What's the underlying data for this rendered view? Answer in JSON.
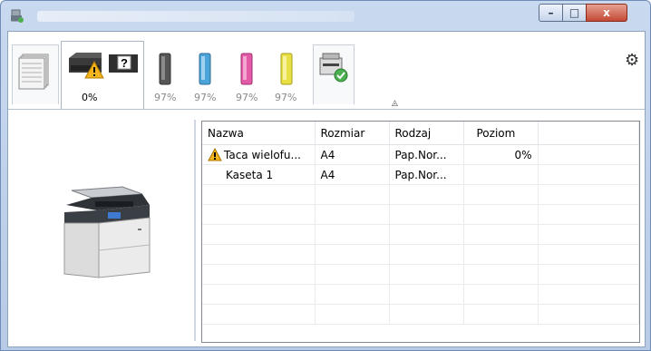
{
  "window": {
    "minimize_label": "–",
    "maximize_label": "□",
    "close_label": "x"
  },
  "toolbar": {
    "tabs": [
      {
        "name": "paper-stack",
        "label": ""
      },
      {
        "name": "printer-status",
        "label": "0%"
      },
      {
        "name": "toner-black",
        "label": "97%",
        "color": "#4d4d4d"
      },
      {
        "name": "toner-cyan",
        "label": "97%",
        "color": "#4aa3d9"
      },
      {
        "name": "toner-magenta",
        "label": "97%",
        "color": "#e45aa7"
      },
      {
        "name": "toner-yellow",
        "label": "97%",
        "color": "#e8df45"
      },
      {
        "name": "device-ok",
        "label": ""
      }
    ],
    "collapse_glyph": "◬",
    "settings_glyph": "⚙",
    "unknown_glyph": "?"
  },
  "table": {
    "columns": [
      "Nazwa",
      "Rozmiar",
      "Rodzaj",
      "Poziom"
    ],
    "rows": [
      {
        "name": "Taca wielofu...",
        "size": "A4",
        "type": "Pap.Nor...",
        "level": "0%",
        "warning": true
      },
      {
        "name": "Kaseta 1",
        "size": "A4",
        "type": "Pap.Nor...",
        "level": "",
        "warning": false
      }
    ],
    "empty_rows": 7
  },
  "colors": {
    "titlebar": "#b7cbe6",
    "close_button": "#c44a33",
    "warning": "#f2b51d"
  }
}
